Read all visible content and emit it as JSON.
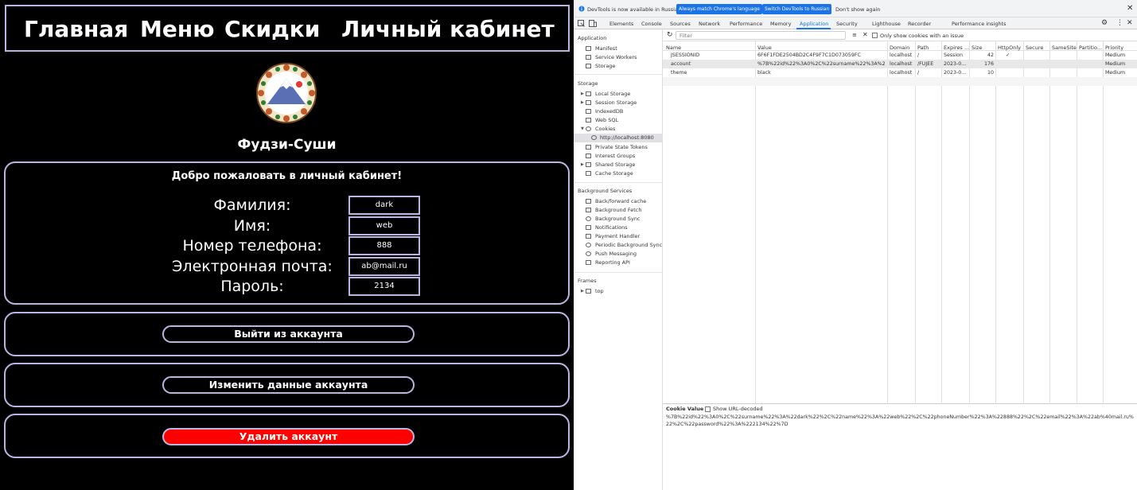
{
  "site": {
    "nav": [
      "Главная",
      "Меню",
      "Скидки",
      "Личный кабинет"
    ],
    "brand": "Фудзи-Суши",
    "welcome": "Добро пожаловать в личный кабинет!",
    "fields": [
      {
        "label": "Фамилия:",
        "value": "dark"
      },
      {
        "label": "Имя:",
        "value": "web"
      },
      {
        "label": "Номер телефона:",
        "value": "888"
      },
      {
        "label": "Электронная почта:",
        "value": "ab@mail.ru"
      },
      {
        "label": "Пароль:",
        "value": "2134"
      }
    ],
    "logout": "Выйти из аккаунта",
    "edit": "Изменить данные аккаунта",
    "delete": "Удалить аккаунт",
    "colors": {
      "border": "#b9b6e6",
      "delete_bg": "#ff0000"
    }
  },
  "devtools": {
    "infobar": {
      "message": "DevTools is now available in Russian!",
      "btn1": "Always match Chrome's language",
      "btn2": "Switch DevTools to Russian",
      "dont_show": "Don't show again"
    },
    "tabs": [
      "Elements",
      "Console",
      "Sources",
      "Network",
      "Performance",
      "Memory",
      "Application",
      "Security",
      "Lighthouse",
      "Recorder",
      "Performance insights"
    ],
    "active_tab": "Application",
    "sidebar": {
      "application": "Application",
      "app_items": [
        "Manifest",
        "Service Workers",
        "Storage"
      ],
      "storage": "Storage",
      "storage_items": [
        "Local Storage",
        "Session Storage",
        "IndexedDB",
        "Web SQL",
        "Cookies",
        "http://localhost:8080",
        "Private State Tokens",
        "Interest Groups",
        "Shared Storage",
        "Cache Storage"
      ],
      "bg": "Background Services",
      "bg_items": [
        "Back/forward cache",
        "Background Fetch",
        "Background Sync",
        "Notifications",
        "Payment Handler",
        "Periodic Background Sync",
        "Push Messaging",
        "Reporting API"
      ],
      "frames": "Frames",
      "frame_items": [
        "top"
      ]
    },
    "toolbar": {
      "filter_placeholder": "Filter",
      "only_issues": "Only show cookies with an issue"
    },
    "columns": [
      "Name",
      "Value",
      "Domain",
      "Path",
      "Expires ...",
      "Size",
      "HttpOnly",
      "Secure",
      "SameSite",
      "Partitio...",
      "Priority"
    ],
    "rows": [
      [
        "JSESSIONID",
        "6F6F1FDE2504BD2C4F9F7C1D073059FC",
        "localhost",
        "/",
        "Session",
        "42",
        "✓",
        "",
        "",
        "",
        "Medium"
      ],
      [
        "account",
        "%7B%22id%22%3A0%2C%22surname%22%3A%22d...",
        "localhost",
        "/FUJEE",
        "2023-0...",
        "176",
        "",
        "",
        "",
        "",
        "Medium"
      ],
      [
        "theme",
        "black",
        "localhost",
        "/",
        "2023-0...",
        "10",
        "",
        "",
        "",
        "",
        "Medium"
      ]
    ],
    "cookie_value": {
      "title": "Cookie Value",
      "decode": "Show URL-decoded",
      "text": "%7B%22id%22%3A0%2C%22surname%22%3A%22dark%22%2C%22name%22%3A%22web%22%2C%22phoneNumber%22%3A%22888%22%2C%22email%22%3A%22ab%40mail.ru%22%2C%22password%22%3A%222134%22%7D"
    }
  }
}
